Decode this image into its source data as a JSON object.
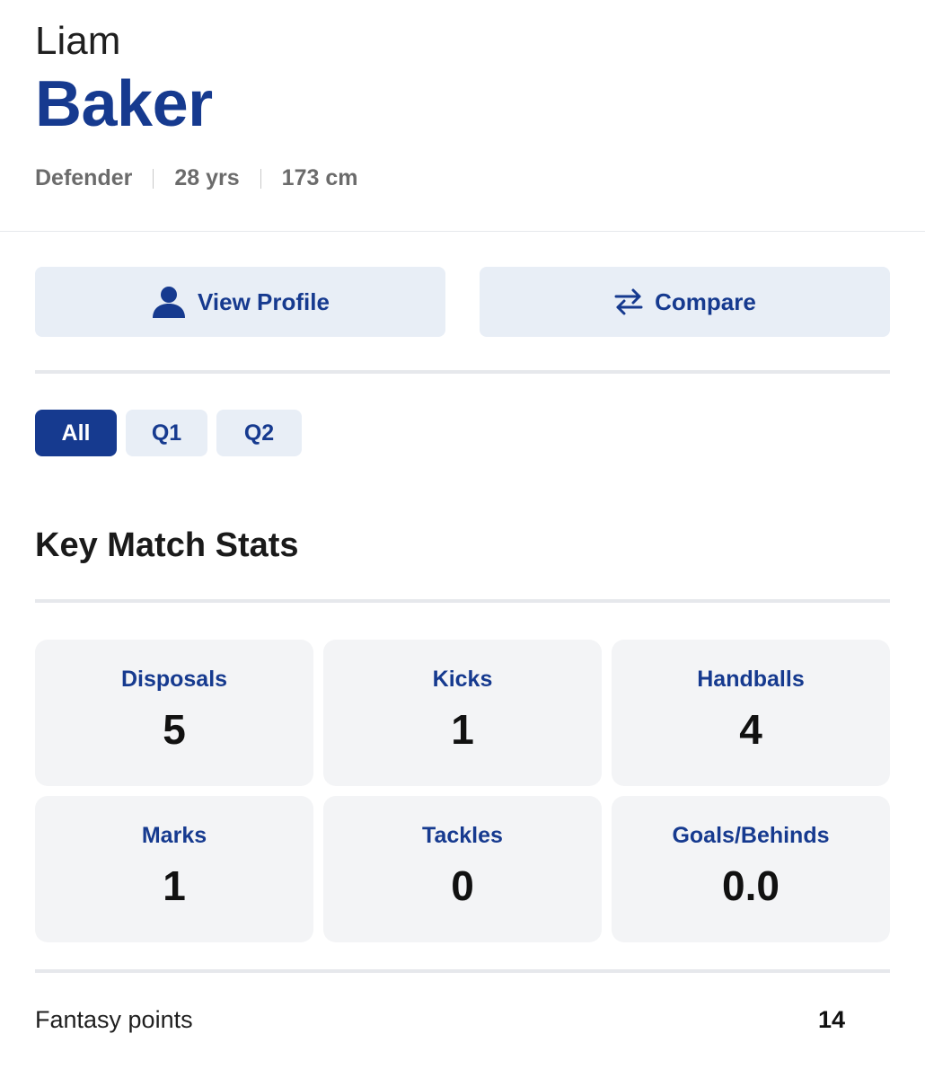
{
  "player": {
    "first_name": "Liam",
    "last_name": "Baker",
    "position": "Defender",
    "age": "28 yrs",
    "height": "173 cm"
  },
  "actions": {
    "view_profile": {
      "label": "View Profile",
      "icon": "person-icon"
    },
    "compare": {
      "label": "Compare",
      "icon": "swap-arrows-icon"
    }
  },
  "tabs": [
    {
      "label": "All",
      "active": true
    },
    {
      "label": "Q1",
      "active": false
    },
    {
      "label": "Q2",
      "active": false
    }
  ],
  "section_title": "Key Match Stats",
  "stats": [
    {
      "label": "Disposals",
      "value": "5"
    },
    {
      "label": "Kicks",
      "value": "1"
    },
    {
      "label": "Handballs",
      "value": "4"
    },
    {
      "label": "Marks",
      "value": "1"
    },
    {
      "label": "Tackles",
      "value": "0"
    },
    {
      "label": "Goals/Behinds",
      "value": "0.0"
    }
  ],
  "fantasy": {
    "label": "Fantasy points",
    "value": "14"
  },
  "colors": {
    "accent": "#163a8f",
    "button_bg": "#e8eef6",
    "card_bg": "#f3f4f6"
  }
}
